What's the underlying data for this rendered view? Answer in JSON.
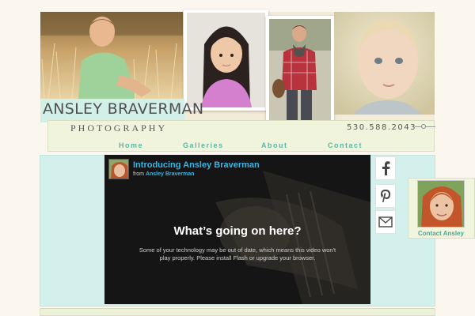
{
  "brand": {
    "name": "ANSLEY BRAVERMAN",
    "subtitle": "PHOTOGRAPHY",
    "phone": "530.588.2043"
  },
  "nav": {
    "items": [
      {
        "label": "Home"
      },
      {
        "label": "Galleries"
      },
      {
        "label": "About"
      },
      {
        "label": "Contact"
      }
    ]
  },
  "video": {
    "title": "Introducing Ansley Braverman",
    "from_label": "from",
    "author": "Ansley Braverman",
    "message_title": "What’s going on here?",
    "message_body": "Some of your technology may be out of date, which means this video won't play properly. Please install Flash or upgrade your browser."
  },
  "social": {
    "icons": [
      "facebook-icon",
      "pinterest-icon",
      "mail-icon"
    ]
  },
  "contact": {
    "label": "Contact Ansley"
  },
  "colors": {
    "accent_teal": "#5ab7a6",
    "video_link_blue": "#37b6e6",
    "mint_panel": "#d4f0ec",
    "cream_panel": "#f0f4dc",
    "page_background": "#fbf6ee"
  }
}
